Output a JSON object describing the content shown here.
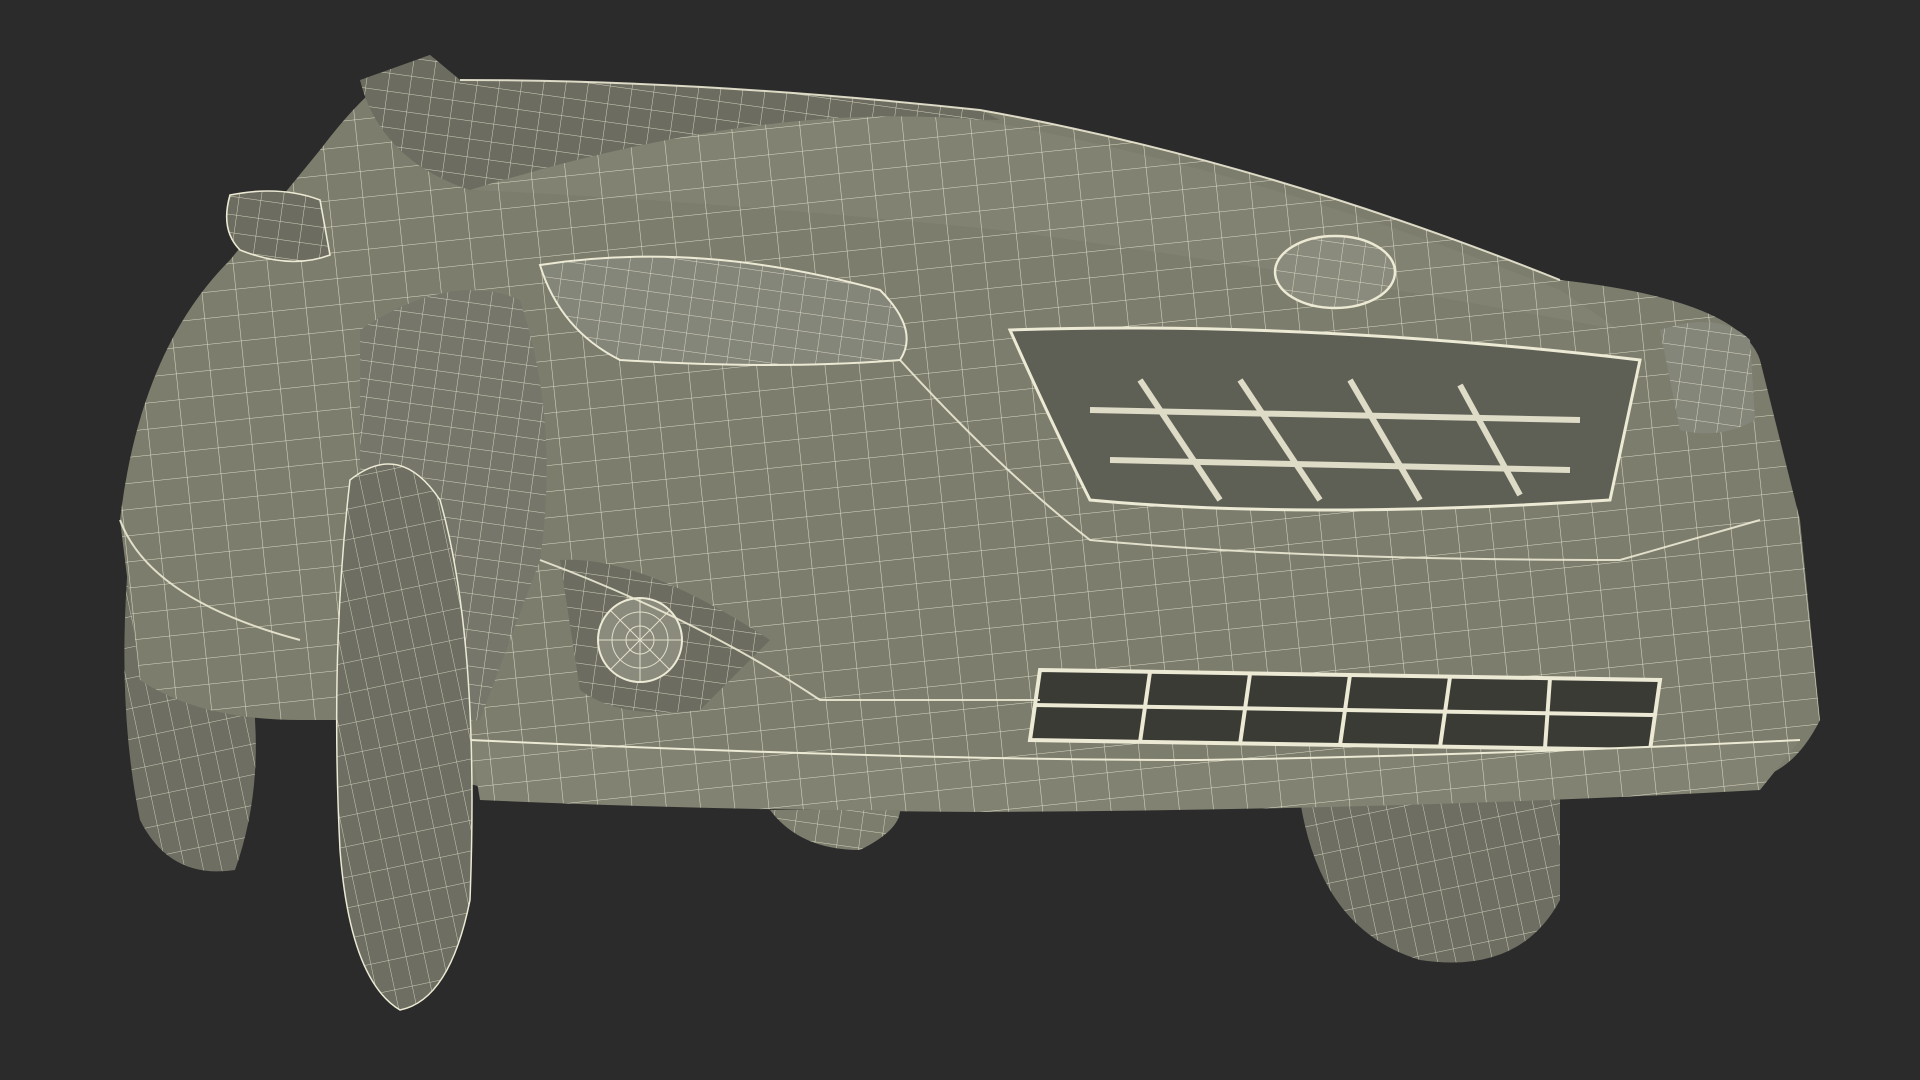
{
  "scene": {
    "subject": "car-wireframe-render",
    "background_color": "#2b2b2b",
    "body_fill": "#7c7d6d",
    "body_fill_dark": "#5f6055",
    "wire_color": "#ece9d4",
    "tire_fill": "#6e6f62",
    "opening_fill": "#3a3b34",
    "icons": [
      "subaru-emblem-icon"
    ]
  }
}
